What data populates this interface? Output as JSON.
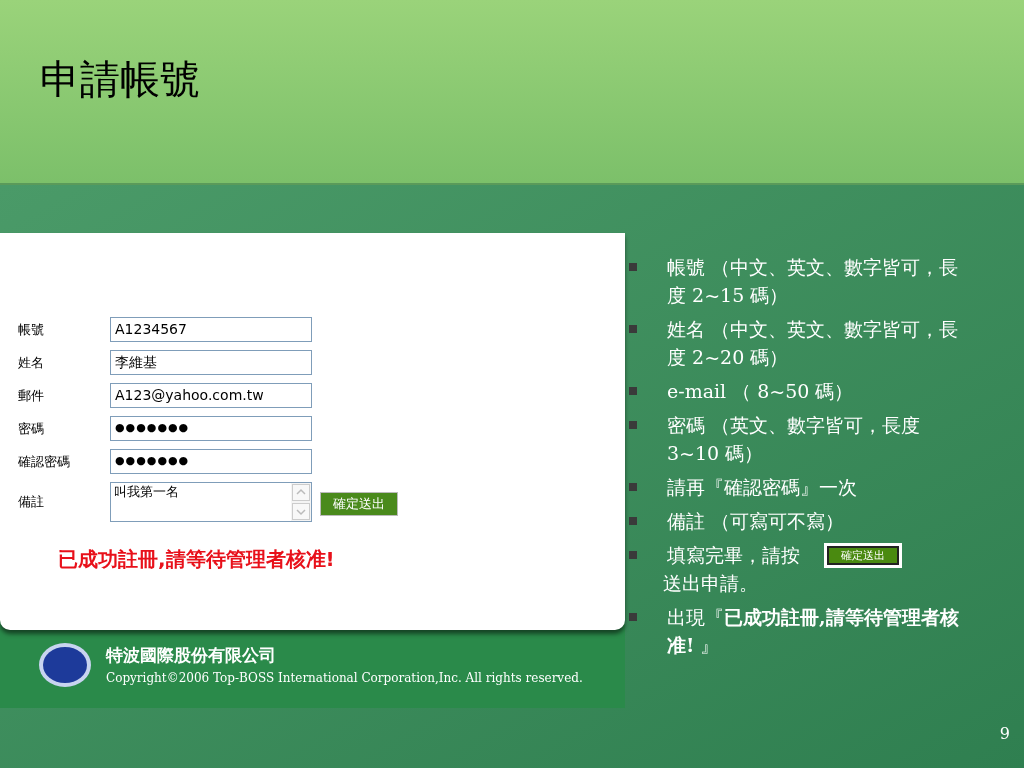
{
  "slide": {
    "title": "申請帳號",
    "page_number": "9"
  },
  "form": {
    "fields": [
      {
        "label": "帳號",
        "value": "A1234567",
        "kind": "text"
      },
      {
        "label": "姓名",
        "value": "李維基",
        "kind": "text"
      },
      {
        "label": "郵件",
        "value": "A123@yahoo.com.tw",
        "kind": "text"
      },
      {
        "label": "密碼",
        "value": "●●●●●●●",
        "kind": "password"
      },
      {
        "label": "確認密碼",
        "value": "●●●●●●●",
        "kind": "password"
      },
      {
        "label": "備註",
        "value": "叫我第一名",
        "kind": "textarea"
      }
    ],
    "submit_label": "確定送出",
    "message": "已成功註冊,請等待管理者核准!"
  },
  "footer": {
    "company": "特波國際股份有限公司",
    "copyright": "Copyright©2006 Top-BOSS International Corporation,Inc. All rights reserved."
  },
  "bullets": [
    {
      "kind": "text",
      "text": "帳號 （中文、英文、數字皆可，長度 2~15 碼）"
    },
    {
      "kind": "text",
      "text": "姓名 （中文、英文、數字皆可，長度 2~20 碼）"
    },
    {
      "kind": "text",
      "text": "e-mail （ 8~50 碼）"
    },
    {
      "kind": "text",
      "text": "密碼 （英文、數字皆可，長度 3~10 碼）"
    },
    {
      "kind": "text",
      "text": "請再『確認密碼』一次"
    },
    {
      "kind": "text",
      "text": "備註 （可寫可不寫）"
    },
    {
      "kind": "button",
      "text": "填寫完畢，請按",
      "button_label": "確定送出",
      "after": "送出申請。"
    },
    {
      "kind": "text",
      "text": "出現『**已成功註冊,請等待管理者核准!** 』"
    }
  ]
}
